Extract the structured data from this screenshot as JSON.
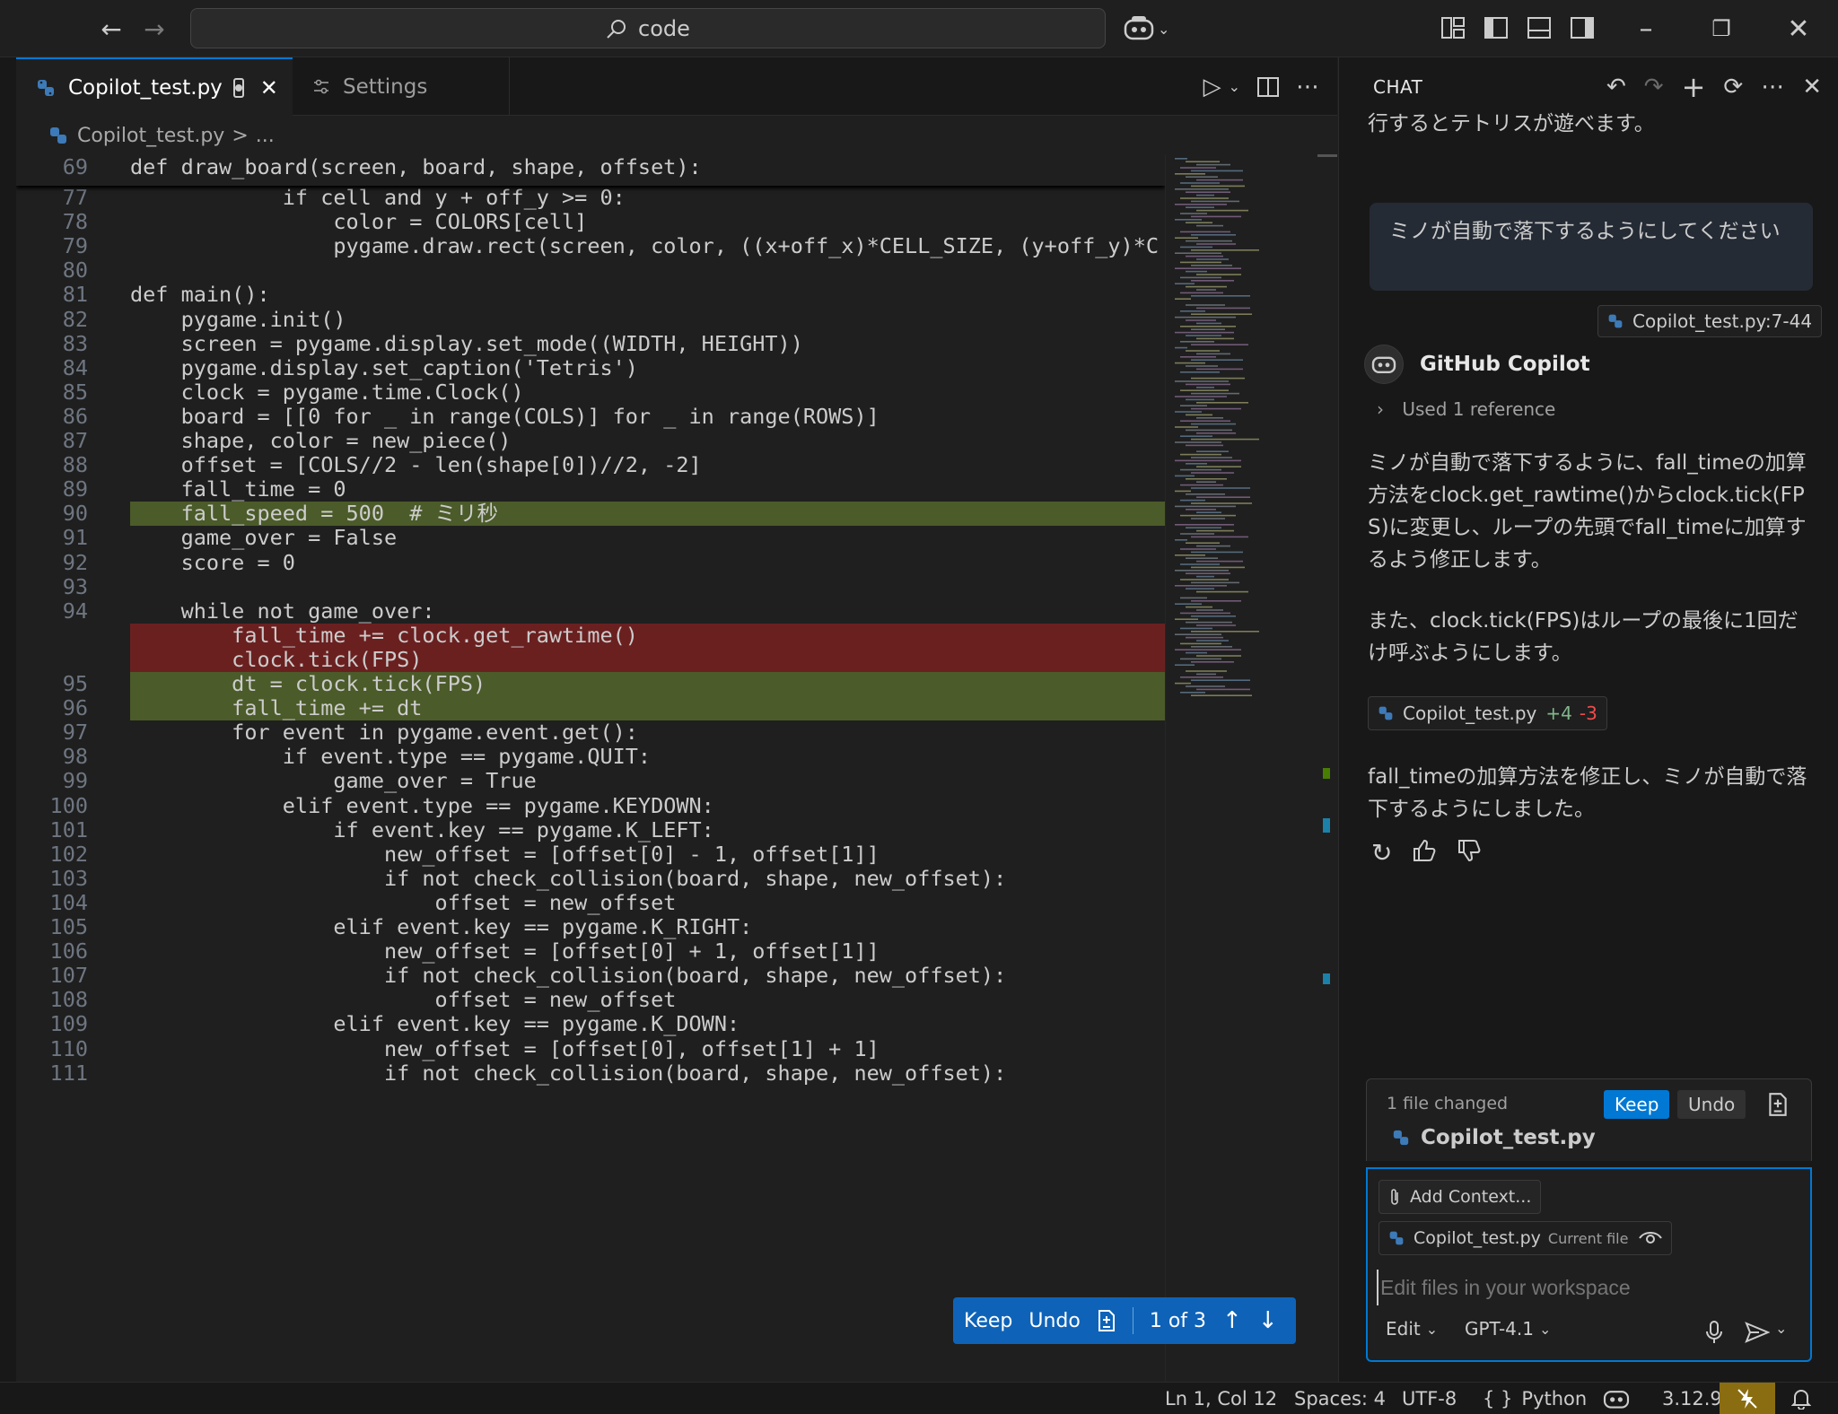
{
  "titlebar": {
    "search_text": "code"
  },
  "tabs": [
    {
      "label": "Copilot_test.py"
    },
    {
      "label": "Settings"
    }
  ],
  "breadcrumb": {
    "file": "Copilot_test.py",
    "sep": ">",
    "rest": "..."
  },
  "sticky": {
    "num": "69",
    "code": "def draw_board(screen, board, shape, offset):"
  },
  "code_lines": [
    {
      "n": "77",
      "text": "            if cell and y + off_y >= 0:"
    },
    {
      "n": "78",
      "text": "                color = COLORS[cell]"
    },
    {
      "n": "79",
      "text": "                pygame.draw.rect(screen, color, ((x+off_x)*CELL_SIZE, (y+off_y)*C"
    },
    {
      "n": "80",
      "text": ""
    },
    {
      "n": "81",
      "text": "def main():"
    },
    {
      "n": "82",
      "text": "    pygame.init()"
    },
    {
      "n": "83",
      "text": "    screen = pygame.display.set_mode((WIDTH, HEIGHT))"
    },
    {
      "n": "84",
      "text": "    pygame.display.set_caption('Tetris')"
    },
    {
      "n": "85",
      "text": "    clock = pygame.time.Clock()"
    },
    {
      "n": "86",
      "text": "    board = [[0 for _ in range(COLS)] for _ in range(ROWS)]"
    },
    {
      "n": "87",
      "text": "    shape, color = new_piece()"
    },
    {
      "n": "88",
      "text": "    offset = [COLS//2 - len(shape[0])//2, -2]"
    },
    {
      "n": "89",
      "text": "    fall_time = 0"
    },
    {
      "n": "90",
      "text": "    fall_speed = 500  # ミリ秒"
    },
    {
      "n": "91",
      "text": "    game_over = False"
    },
    {
      "n": "92",
      "text": "    score = 0"
    },
    {
      "n": "93",
      "text": ""
    },
    {
      "n": "94",
      "text": "    while not game_over:"
    },
    {
      "n": "",
      "text": "        fall_time += clock.get_rawtime()"
    },
    {
      "n": "",
      "text": "        clock.tick(FPS)"
    },
    {
      "n": "95",
      "text": "        dt = clock.tick(FPS)"
    },
    {
      "n": "96",
      "text": "        fall_time += dt"
    },
    {
      "n": "97",
      "text": "        for event in pygame.event.get():"
    },
    {
      "n": "98",
      "text": "            if event.type == pygame.QUIT:"
    },
    {
      "n": "99",
      "text": "                game_over = True"
    },
    {
      "n": "100",
      "text": "            elif event.type == pygame.KEYDOWN:"
    },
    {
      "n": "101",
      "text": "                if event.key == pygame.K_LEFT:"
    },
    {
      "n": "102",
      "text": "                    new_offset = [offset[0] - 1, offset[1]]"
    },
    {
      "n": "103",
      "text": "                    if not check_collision(board, shape, new_offset):"
    },
    {
      "n": "104",
      "text": "                        offset = new_offset"
    },
    {
      "n": "105",
      "text": "                elif event.key == pygame.K_RIGHT:"
    },
    {
      "n": "106",
      "text": "                    new_offset = [offset[0] + 1, offset[1]]"
    },
    {
      "n": "107",
      "text": "                    if not check_collision(board, shape, new_offset):"
    },
    {
      "n": "108",
      "text": "                        offset = new_offset"
    },
    {
      "n": "109",
      "text": "                elif event.key == pygame.K_DOWN:"
    },
    {
      "n": "110",
      "text": "                    new_offset = [offset[0], offset[1] + 1]"
    },
    {
      "n": "111",
      "text": "                    if not check_collision(board, shape, new_offset):"
    }
  ],
  "keepbar": {
    "keep": "Keep",
    "undo": "Undo",
    "counter": "1 of 3"
  },
  "chat": {
    "title": "CHAT",
    "top_text": "行するとテトリスが遊べます。",
    "user_message": "ミノが自動で落下するようにしてください",
    "user_ref": "Copilot_test.py:7-44",
    "assistant_name": "GitHub Copilot",
    "used_ref": "Used 1 reference",
    "para1": "ミノが自動で落下するように、fall_timeの加算方法をclock.get_rawtime()からclock.tick(FPS)に変更し、ループの先頭でfall_timeに加算するよう修正します。",
    "para2": "また、clock.tick(FPS)はループの最後に1回だけ呼ぶようにします。",
    "edit_chip": {
      "file": "Copilot_test.py",
      "added": "+4",
      "removed": "-3"
    },
    "para3": "fall_timeの加算方法を修正し、ミノが自動で落下するようにしました。",
    "changes": {
      "summary": "1 file changed",
      "keep": "Keep",
      "undo": "Undo",
      "file": "Copilot_test.py"
    },
    "input": {
      "add_context": "Add Context...",
      "current_file": "Copilot_test.py",
      "current_file_tag": "Current file",
      "placeholder": "Edit files in your workspace",
      "mode": "Edit",
      "model": "GPT-4.1"
    }
  },
  "status": {
    "position": "Ln 1, Col 12",
    "spaces": "Spaces: 4",
    "encoding": "UTF-8",
    "language": "Python",
    "version": "3.12.9",
    "language_glyph": "{ }"
  },
  "colors": {
    "accent": "#0078d4",
    "added_bg": "#4b5b29",
    "removed_bg": "#6b2020"
  }
}
